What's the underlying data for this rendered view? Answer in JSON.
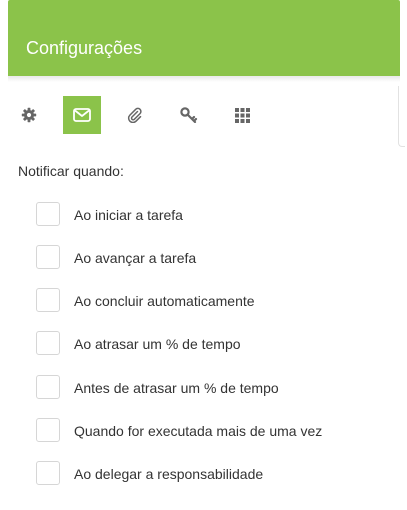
{
  "header": {
    "title": "Configurações",
    "color": "#8bc34a"
  },
  "tabs": [
    {
      "icon": "gear-icon",
      "active": false
    },
    {
      "icon": "envelope-icon",
      "active": true
    },
    {
      "icon": "paperclip-icon",
      "active": false
    },
    {
      "icon": "key-icon",
      "active": false
    },
    {
      "icon": "grid-icon",
      "active": false
    }
  ],
  "notify": {
    "label": "Notificar quando:",
    "options": [
      {
        "label": "Ao iniciar a tarefa",
        "checked": false
      },
      {
        "label": "Ao avançar a tarefa",
        "checked": false
      },
      {
        "label": "Ao concluir automaticamente",
        "checked": false
      },
      {
        "label": "Ao atrasar um % de tempo",
        "checked": false
      },
      {
        "label": "Antes de atrasar um % de tempo",
        "checked": false
      },
      {
        "label": "Quando for executada mais de uma vez",
        "checked": false
      },
      {
        "label": "Ao delegar a responsabilidade",
        "checked": false
      }
    ]
  }
}
